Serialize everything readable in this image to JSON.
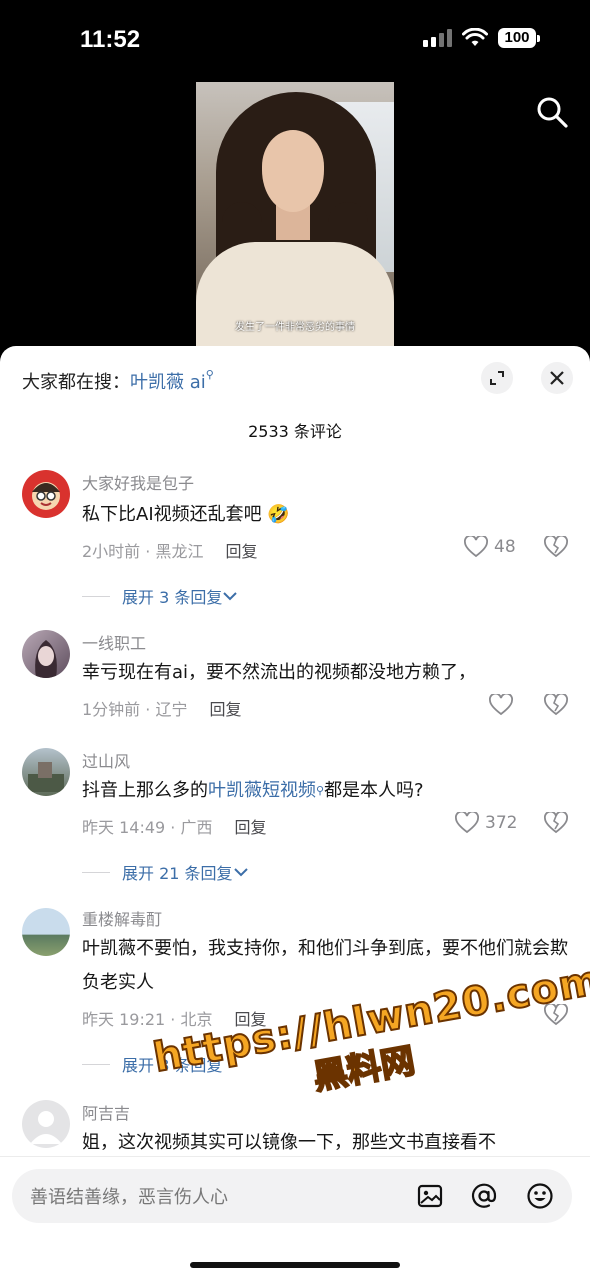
{
  "status": {
    "time": "11:52",
    "battery": "100"
  },
  "video": {
    "subtitle": "发生了一件非常恶劣的事情"
  },
  "header": {
    "hot_prefix": "大家都在搜：",
    "hot_keyword": "叶凯薇 ai",
    "comment_count": "2533 条评论"
  },
  "comments": [
    {
      "name": "大家好我是包子",
      "text": "私下比AI视频还乱套吧 🤣",
      "time": "2小时前 · 黑龙江",
      "reply": "回复",
      "likes": "48",
      "expand": "展开 3 条回复"
    },
    {
      "name": "一线职工",
      "text": "幸亏现在有ai，要不然流出的视频都没地方赖了，",
      "time": "1分钟前 · 辽宁",
      "reply": "回复",
      "likes": ""
    },
    {
      "name": "过山风",
      "text_pre": "抖音上那么多的",
      "text_link": "叶凯薇短视频",
      "text_post": "都是本人吗?",
      "time": "昨天 14:49 · 广西",
      "reply": "回复",
      "likes": "372",
      "expand": "展开 21 条回复"
    },
    {
      "name": "重楼解毒酊",
      "text": "叶凯薇不要怕，我支持你，和他们斗争到底，要不他们就会欺负老实人",
      "time": "昨天 19:21 · 北京",
      "reply": "回复",
      "expand": "展开 8 条回复"
    },
    {
      "name": "阿吉吉",
      "text": "姐，这次视频其实可以镜像一下，那些文书直接看不"
    }
  ],
  "watermark": {
    "line1": "https://hlwn20.com",
    "line2": "黑料网"
  },
  "input": {
    "placeholder": "善语结善缘，恶言伤人心"
  },
  "icons": [
    "search-icon",
    "expand-icon",
    "close-icon",
    "heart-icon",
    "broken-heart-icon",
    "chevron-down-icon",
    "image-icon",
    "at-icon",
    "emoji-icon"
  ]
}
